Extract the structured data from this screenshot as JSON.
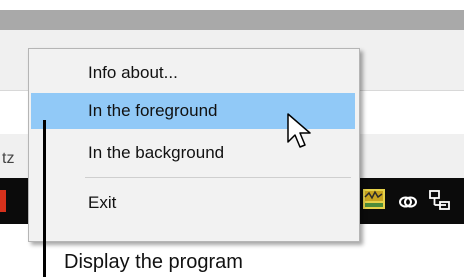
{
  "status_bar": {
    "fragment": "tz"
  },
  "context_menu": {
    "items": [
      {
        "label": "Info about..."
      },
      {
        "label": "In the foreground",
        "highlighted": true
      },
      {
        "label": "In the background"
      },
      {
        "label": "Exit"
      }
    ]
  },
  "annotation": {
    "caption": "Display the program"
  },
  "colors": {
    "highlight": "#91c9f7",
    "taskbar": "#0b0b0b",
    "title_bar": "#a9a9a9"
  },
  "tray_icons": [
    "app-tray-icon",
    "link-icon",
    "network-icon"
  ]
}
